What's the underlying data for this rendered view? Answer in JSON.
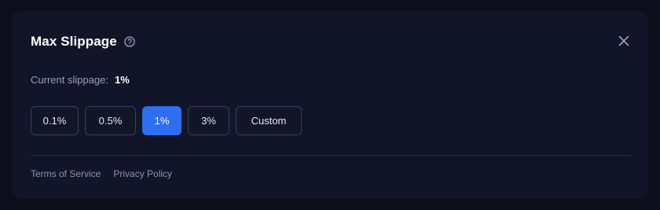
{
  "dialog": {
    "title": "Max Slippage",
    "help_icon": "question-circle-icon",
    "close_icon": "close-icon"
  },
  "current": {
    "label": "Current slippage:",
    "value": "1%"
  },
  "options": [
    {
      "label": "0.1%",
      "selected": false
    },
    {
      "label": "0.5%",
      "selected": false
    },
    {
      "label": "1%",
      "selected": true
    },
    {
      "label": "3%",
      "selected": false
    },
    {
      "label": "Custom",
      "selected": false
    }
  ],
  "footer": {
    "links": [
      "Terms of Service",
      "Privacy Policy"
    ]
  },
  "colors": {
    "accent": "#2e6ef3",
    "background": "#0c0e1c",
    "panel": "#121527"
  }
}
